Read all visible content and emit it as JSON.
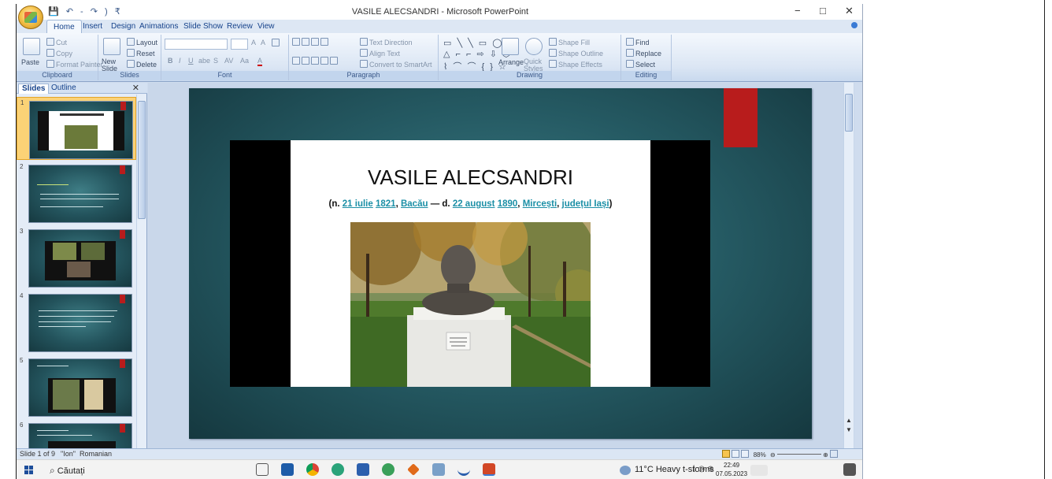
{
  "window": {
    "title": "VASILE ALECSANDRI - Microsoft PowerPoint",
    "qat": "💾 ↶ - ↷ ) ₹",
    "minimize": "−",
    "restore": "□",
    "close": "✕"
  },
  "ribbon": {
    "tabs": [
      "Home",
      "Insert",
      "Design",
      "Animations",
      "Slide Show",
      "Review",
      "View"
    ],
    "clipboard": {
      "paste": "Paste",
      "cut": "Cut",
      "copy": "Copy",
      "format_painter": "Format Painter",
      "label": "Clipboard"
    },
    "slides": {
      "new_slide": "New Slide",
      "layout": "Layout",
      "reset": "Reset",
      "delete": "Delete",
      "label": "Slides"
    },
    "font": {
      "label": "Font",
      "bold": "B",
      "italic": "I",
      "underline": "U",
      "strike": "abe",
      "shadow": "S",
      "spacing": "AV",
      "case": "Aa",
      "color": "A",
      "grow": "A",
      "shrink": "A"
    },
    "paragraph": {
      "text_direction": "Text Direction",
      "align_text": "Align Text",
      "convert_smartart": "Convert to SmartArt",
      "label": "Paragraph"
    },
    "drawing": {
      "arrange": "Arrange",
      "quick_styles": "Quick Styles",
      "shape_fill": "Shape Fill",
      "shape_outline": "Shape Outline",
      "shape_effects": "Shape Effects",
      "label": "Drawing"
    },
    "editing": {
      "find": "Find",
      "replace": "Replace",
      "select": "Select",
      "label": "Editing"
    }
  },
  "pane": {
    "tabs": [
      "Slides",
      "Outline"
    ],
    "close": "✕",
    "thumbnails": [
      {
        "num": "1"
      },
      {
        "num": "2"
      },
      {
        "num": "3"
      },
      {
        "num": "4"
      },
      {
        "num": "5"
      },
      {
        "num": "6"
      }
    ]
  },
  "slide": {
    "title": "VASILE ALECSANDRI",
    "sub_prefix": "(n. ",
    "date_day": "21 iulie",
    "birth_year": "1821",
    "birth_place": "Bacău",
    "sub_mid": " — d. ",
    "death_day": "22 august",
    "death_year": "1890",
    "death_place": "Mircești",
    "county": "județul Iași",
    "sub_end": ")",
    "photo_plaque": "VASILE ALECSANDRI 1821-1890"
  },
  "status": {
    "slide_info": "Slide 1 of 9",
    "theme": "\"Ion\"",
    "language": "Romanian",
    "zoom": "88%"
  },
  "taskbar": {
    "search_placeholder": "Căutați",
    "weather": "11°C  Heavy t-storms",
    "time": "22:49",
    "date": "07.05.2023"
  },
  "colors": {
    "accent_red": "#b81c1c",
    "slide_teal": "#255a63",
    "link": "#1b8fa6"
  }
}
